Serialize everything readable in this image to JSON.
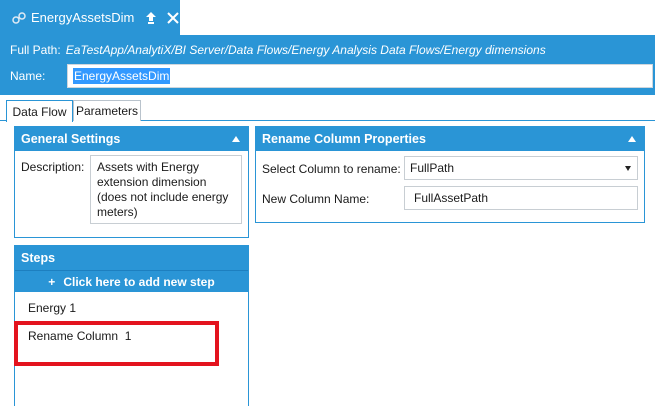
{
  "window": {
    "tab_title": "EnergyAssetsDim",
    "icons": {
      "doc": "dataflow-icon",
      "pin": "pin-icon",
      "close": "close-icon"
    }
  },
  "header": {
    "full_path_label": "Full Path:",
    "full_path_value": "EaTestApp/AnalytiX/BI Server/Data Flows/Energy Analysis Data Flows/Energy dimensions",
    "name_label": "Name:",
    "name_value": "EnergyAssetsDim"
  },
  "subtabs": [
    {
      "label": "Data Flow",
      "active": true
    },
    {
      "label": "Parameters",
      "active": false
    }
  ],
  "general_settings": {
    "title": "General Settings",
    "description_label": "Description:",
    "description_lines": [
      "Assets with Energy",
      "extension dimension",
      "(does not include energy",
      "meters)"
    ]
  },
  "rename_column": {
    "title": "Rename Column Properties",
    "select_label": "Select Column to rename:",
    "select_value": "FullPath",
    "new_name_label": "New Column Name:",
    "new_name_value": "FullAssetPath"
  },
  "steps": {
    "title": "Steps",
    "add_button": "Click here to add new step",
    "add_plus": "+",
    "items": [
      "Energy 1",
      "Rename Column  1"
    ]
  },
  "colors": {
    "accent": "#2a95d6",
    "highlight": "#e3131e",
    "selection": "#3399ff"
  }
}
